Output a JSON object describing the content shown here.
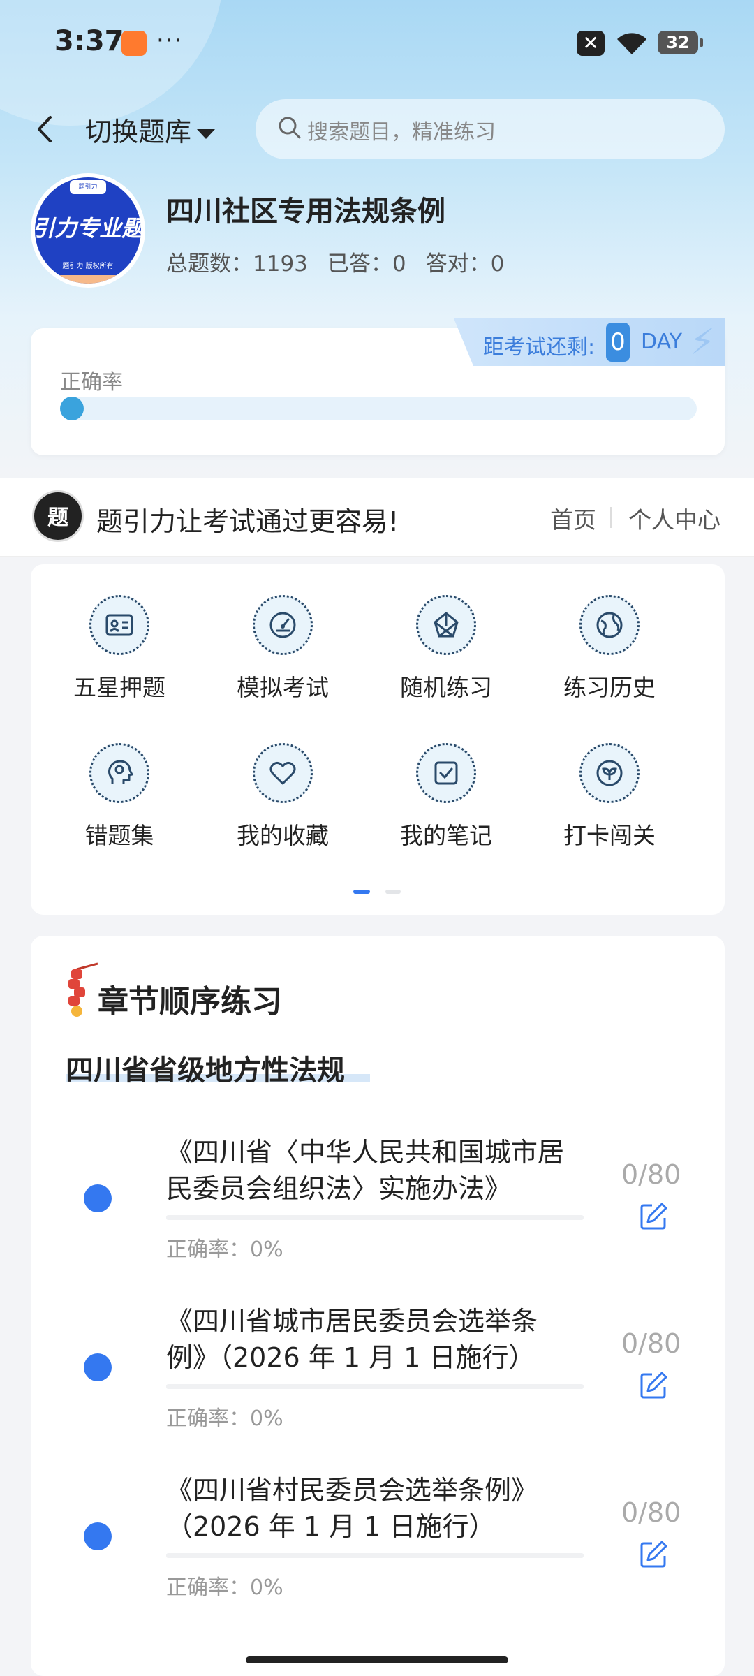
{
  "status_bar": {
    "time": "3:37",
    "more": "···",
    "battery": "32"
  },
  "nav": {
    "switch_label": "切换题库",
    "search_placeholder": "搜索题目，精准练习"
  },
  "bank": {
    "logo_text": "引力专业题",
    "logo_small": "题引力 版权所有",
    "logo_tag": "题引力",
    "title": "四川社区专用法规条例",
    "total_label": "总题数：1193",
    "answered_label": "已答：0",
    "correct_label": "答对：0"
  },
  "accuracy": {
    "label": "正确率",
    "value_fraction": 0.0,
    "countdown_label": "距考试还剩:",
    "countdown_value": "0",
    "countdown_unit": "DAY"
  },
  "slogan": {
    "badge": "题引力",
    "text": "题引力让考试通过更容易!",
    "home": "首页",
    "personal": "个人中心"
  },
  "grid": {
    "items": [
      {
        "label": "五星押题",
        "icon": "id-card-icon"
      },
      {
        "label": "模拟考试",
        "icon": "speedometer-icon"
      },
      {
        "label": "随机练习",
        "icon": "random-network-icon"
      },
      {
        "label": "练习历史",
        "icon": "globe-icon"
      },
      {
        "label": "错题集",
        "icon": "head-icon"
      },
      {
        "label": "我的收藏",
        "icon": "heart-icon"
      },
      {
        "label": "我的笔记",
        "icon": "note-check-icon"
      },
      {
        "label": "打卡闯关",
        "icon": "leaf-badge-icon"
      }
    ],
    "page_index": 0,
    "page_count": 2
  },
  "chapter": {
    "title": "章节顺序练习",
    "section": "四川省省级地方性法规",
    "items": [
      {
        "name_line1": "《四川省〈中华人民共和国城市居",
        "name_line2": "民委员会组织法〉实施办法》",
        "rate": "正确率：0%",
        "count": "0/80"
      },
      {
        "name_line1": "《四川省城市居民委员会选举条",
        "name_line2": "例》（2026 年 1 月 1 日施行）",
        "rate": "正确率：0%",
        "count": "0/80"
      },
      {
        "name_line1": "《四川省村民委员会选举条例》",
        "name_line2": "（2026 年 1 月 1 日施行）",
        "rate": "正确率：0%",
        "count": "0/80"
      }
    ]
  },
  "colors": {
    "accent": "#3478f0",
    "progress": "#3aa3dd",
    "logo_blue": "#1f41c3"
  }
}
